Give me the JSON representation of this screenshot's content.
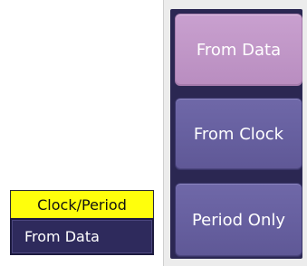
{
  "selector": {
    "header_label": "Clock/Period",
    "current_value": "From Data",
    "header_color": "#ffff0c"
  },
  "panel": {
    "options": [
      {
        "label": "From Data",
        "selected": true
      },
      {
        "label": "From Clock",
        "selected": false
      },
      {
        "label": "Period Only",
        "selected": false
      }
    ],
    "selected_color": "#c9a0cf",
    "normal_color": "#6760a0"
  }
}
